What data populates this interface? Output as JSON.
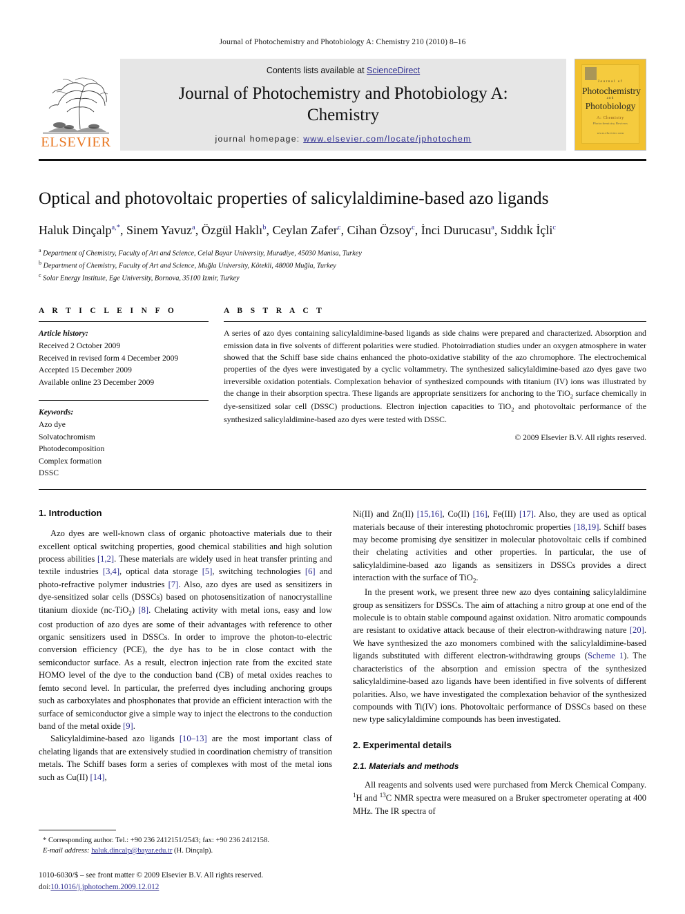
{
  "running_head": "Journal of Photochemistry and Photobiology A: Chemistry 210 (2010) 8–16",
  "masthead": {
    "contents_prefix": "Contents lists available at ",
    "sciencedirect": "ScienceDirect",
    "journal_title": "Journal of Photochemistry and Photobiology A: Chemistry",
    "homepage_prefix": "journal homepage: ",
    "homepage_url": "www.elsevier.com/locate/jphotochem",
    "publisher": "ELSEVIER",
    "link_color": "#2c2c8f",
    "elsevier_orange": "#E87722",
    "cover": {
      "journal_of": "Journal of",
      "line1": "Photochemistry",
      "and": "and",
      "line2": "Photobiology",
      "section": "A: Chemistry",
      "subtitle": "Photochemistry Reviews",
      "url": "www.elsevier.com",
      "bg_color": "#F2C12E"
    }
  },
  "article": {
    "title": "Optical and photovoltaic properties of salicylaldimine-based azo ligands",
    "authors": [
      {
        "name": "Haluk Dinçalp",
        "marks": "a,*"
      },
      {
        "name": "Sinem Yavuz",
        "marks": "a"
      },
      {
        "name": "Özgül Haklı",
        "marks": "b"
      },
      {
        "name": "Ceylan Zafer",
        "marks": "c"
      },
      {
        "name": "Cihan Özsoy",
        "marks": "c"
      },
      {
        "name": "İnci Durucasu",
        "marks": "a"
      },
      {
        "name": "Sıddık İçli",
        "marks": "c"
      }
    ],
    "affiliations": [
      {
        "mark": "a",
        "text": "Department of Chemistry, Faculty of Art and Science, Celal Bayar University, Muradiye, 45030 Manisa, Turkey"
      },
      {
        "mark": "b",
        "text": "Department of Chemistry, Faculty of Art and Science, Muğla University, Kötekli, 48000 Muğla, Turkey"
      },
      {
        "mark": "c",
        "text": "Solar Energy Institute, Ege University, Bornova, 35100 Izmir, Turkey"
      }
    ]
  },
  "article_info": {
    "heading": "A R T I C L E   I N F O",
    "history_label": "Article history:",
    "history": [
      "Received 2 October 2009",
      "Received in revised form 4 December 2009",
      "Accepted 15 December 2009",
      "Available online 23 December 2009"
    ],
    "keywords_label": "Keywords:",
    "keywords": [
      "Azo dye",
      "Solvatochromism",
      "Photodecomposition",
      "Complex formation",
      "DSSC"
    ]
  },
  "abstract": {
    "heading": "A B S T R A C T",
    "paragraph_1": "A series of azo dyes containing salicylaldimine-based ligands as side chains were prepared and characterized. Absorption and emission data in five solvents of different polarities were studied. Photoirradiation studies under an oxygen atmosphere in water showed that the Schiff base side chains enhanced the photo-oxidative stability of the azo chromophore. The electrochemical properties of the dyes were investigated by a cyclic voltammetry. The synthesized salicylaldimine-based azo dyes gave two irreversible oxidation potentials. Complexation behavior of synthesized compounds with titanium (IV) ions was illustrated by the change in their absorption spectra. These ligands are appropriate sensitizers for anchoring to the TiO",
    "paragraph_1b": " surface chemically in dye-sensitized solar cell (DSSC) productions. Electron injection capacities to TiO",
    "paragraph_1c": " and photovoltaic performance of the synthesized salicylaldimine-based azo dyes were tested with DSSC.",
    "copyright": "© 2009 Elsevier B.V. All rights reserved."
  },
  "body": {
    "section_1_heading": "1. Introduction",
    "p1a": "Azo dyes are well-known class of organic photoactive materials due to their excellent optical switching properties, good chemical stabilities and high solution process abilities ",
    "p1_r1": "[1,2]",
    "p1b": ". These materials are widely used in heat transfer printing and textile industries ",
    "p1_r2": "[3,4]",
    "p1c": ", optical data storage ",
    "p1_r3": "[5]",
    "p1d": ", switching technologies ",
    "p1_r4": "[6]",
    "p1e": " and photo-refractive polymer industries ",
    "p1_r5": "[7]",
    "p1f": ". Also, azo dyes are used as sensitizers in dye-sensitized solar cells (DSSCs) based on photosensitization of nanocrystalline titanium dioxide (nc-TiO",
    "p1g": ") ",
    "p1_r6": "[8]",
    "p1h": ". Chelating activity with metal ions, easy and low cost production of azo dyes are some of their advantages with reference to other organic sensitizers used in DSSCs. In order to improve the photon-to-electric conversion efficiency (PCE), the dye has to be in close contact with the semiconductor surface. As a result, electron injection rate from the excited state HOMO level of the dye to the conduction band (CB) of metal oxides reaches to femto second level. In particular, the preferred dyes including anchoring groups such as carboxylates and phosphonates that provide an efficient interaction with the surface of semiconductor give a simple way to inject the electrons to the conduction band of the metal oxide ",
    "p1_r7": "[9]",
    "p1i": ".",
    "p2a": "Salicylaldimine-based azo ligands ",
    "p2_r1": "[10–13]",
    "p2b": " are the most important class of chelating ligands that are extensively studied in coordination chemistry of transition metals. The Schiff bases form a series of complexes with most of the metal ions such as Cu(II) ",
    "p2_r2": "[14]",
    "p2c": ",",
    "p3a": "Ni(II) and Zn(II) ",
    "p3_r1": "[15,16]",
    "p3b": ", Co(II) ",
    "p3_r2": "[16]",
    "p3c": ", Fe(III) ",
    "p3_r3": "[17]",
    "p3d": ". Also, they are used as optical materials because of their interesting photochromic properties ",
    "p3_r4": "[18,19]",
    "p3e": ". Schiff bases may become promising dye sensitizer in molecular photovoltaic cells if combined their chelating activities and other properties. In particular, the use of salicylaldimine-based azo ligands as sensitizers in DSSCs provides a direct interaction with the surface of TiO",
    "p3f": ".",
    "p4a": "In the present work, we present three new azo dyes containing salicylaldimine group as sensitizers for DSSCs. The aim of attaching a nitro group at one end of the molecule is to obtain stable compound against oxidation. Nitro aromatic compounds are resistant to oxidative attack because of their electron-withdrawing nature ",
    "p4_r1": "[20]",
    "p4b": ". We have synthesized the azo monomers combined with the salicylaldimine-based ligands substituted with different electron-withdrawing groups (",
    "p4_scheme": "Scheme 1",
    "p4c": "). The characteristics of the absorption and emission spectra of the synthesized salicylaldimine-based azo ligands have been identified in five solvents of different polarities. Also, we have investigated the complexation behavior of the synthesized compounds with Ti(IV) ions. Photovoltaic performance of DSSCs based on these new type salicylaldimine compounds has been investigated.",
    "section_2_heading": "2. Experimental details",
    "section_21_heading": "2.1. Materials and methods",
    "p5a": "All reagents and solvents used were purchased from Merck Chemical Company. ",
    "p5_h": "1",
    "p5b": "H and ",
    "p5_c": "13",
    "p5c": "C NMR spectra were measured on a Bruker spectrometer operating at 400 MHz. The IR spectra of"
  },
  "footnotes": {
    "corresponding": "* Corresponding author. Tel.: +90 236 2412151/2543; fax: +90 236 2412158.",
    "email_label": "E-mail address:",
    "email": "haluk.dincalp@bayar.edu.tr",
    "email_suffix": " (H. Dinçalp).",
    "issn_line": "1010-6030/$ – see front matter © 2009 Elsevier B.V. All rights reserved.",
    "doi_label": "doi:",
    "doi": "10.1016/j.jphotochem.2009.12.012"
  }
}
